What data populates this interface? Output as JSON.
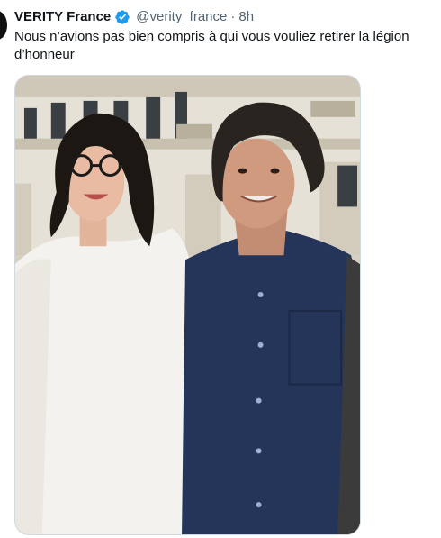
{
  "tweet": {
    "author": {
      "display_name": "VERITY France",
      "handle": "@verity_france",
      "verified_icon": "verified-badge-icon"
    },
    "separator": "·",
    "timestamp": "8h",
    "text": "Nous n’avions pas bien compris à qui vous vouliez retirer la légion d’honneur",
    "media": {
      "type": "photo"
    }
  },
  "colors": {
    "verified_blue": "#1d9bf0",
    "secondary_text": "#536471",
    "primary_text": "#0f1419",
    "card_border": "#cfd9de"
  }
}
